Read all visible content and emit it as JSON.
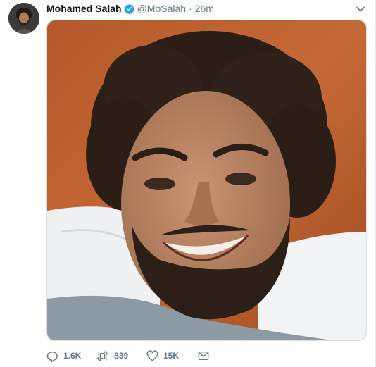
{
  "tweet": {
    "author": {
      "name": "Mohamed Salah",
      "handle": "@MoSalah",
      "verified": true
    },
    "separator": "·",
    "time": "26m",
    "media": {
      "alt": "selfie photo"
    },
    "actions": {
      "replies": "1.6K",
      "retweets": "839",
      "likes": "15K"
    }
  },
  "colors": {
    "verified": "#1da1f2",
    "muted": "#657786",
    "text": "#14171a"
  },
  "icons": [
    "verified-badge-icon",
    "chevron-down-icon",
    "reply-icon",
    "retweet-icon",
    "like-icon",
    "direct-message-icon"
  ]
}
